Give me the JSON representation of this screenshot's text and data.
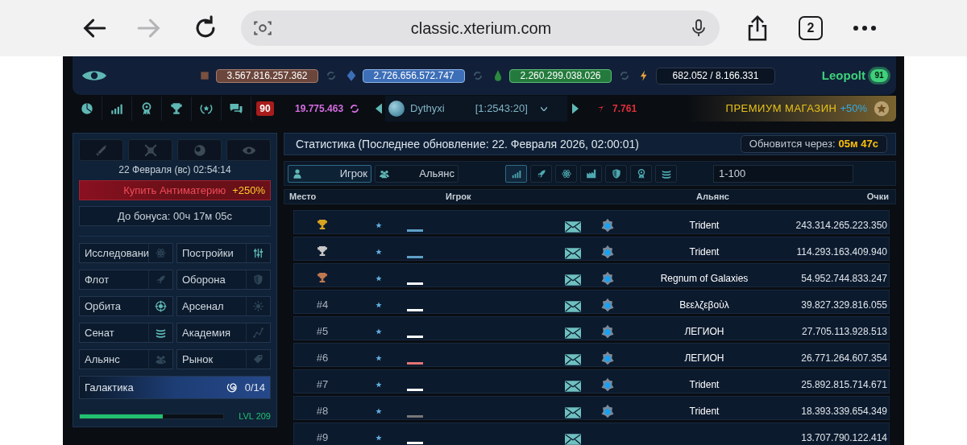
{
  "browser": {
    "url": "classic.xterium.com",
    "tab_count": "2",
    "forward_disabled": true
  },
  "header": {
    "resources": [
      {
        "kind": "metal",
        "value": "3.567.816.257.362"
      },
      {
        "kind": "crystal",
        "value": "2.726.656.572.747"
      },
      {
        "kind": "deuterium",
        "value": "2.260.299.038.026"
      }
    ],
    "energy": "682.052 / 8.166.331",
    "player": "Leopolt",
    "player_level": "91"
  },
  "subheader": {
    "messages_badge": "90",
    "antimatter": "19.775.463",
    "planet": "Dythyxi",
    "coords": "[1:2543:20]",
    "darkmatter": "7.761",
    "premium": "ПРЕМИУМ МАГАЗИН",
    "premium_bonus": "+50%"
  },
  "sidebar": {
    "date": "22 Февраля (вс) 02:54:14",
    "buy": "Купить Антиматерию",
    "buy_bonus": "+250%",
    "bonus_timer": "До бонуса: 00ч 17м 05с",
    "items": [
      {
        "label": "Исследовани",
        "bright": false
      },
      {
        "label": "Постройки",
        "bright": true
      },
      {
        "label": "Флот",
        "bright": false
      },
      {
        "label": "Оборона",
        "bright": false
      },
      {
        "label": "Орбита",
        "bright": true
      },
      {
        "label": "Арсенал",
        "bright": false
      },
      {
        "label": "Сенат",
        "bright": true
      },
      {
        "label": "Академия",
        "bright": false
      },
      {
        "label": "Альянс",
        "bright": false
      },
      {
        "label": "Рынок",
        "bright": false
      }
    ],
    "galaxy": {
      "label": "Галактика",
      "count": "0/14"
    },
    "level": {
      "level": 0.58,
      "label": "LVL 209"
    }
  },
  "stats": {
    "title": "Статистика (Последнее обновление: 22. Февраля 2026, 02:00:01)",
    "refresh_label": "Обновится через:",
    "refresh_time": "05м 47с",
    "modes": [
      {
        "label": "Игрок",
        "selected": true
      },
      {
        "label": "Альянс",
        "selected": false
      }
    ],
    "categories": [
      {
        "selected": true
      },
      {
        "selected": false
      },
      {
        "selected": false
      },
      {
        "selected": false
      },
      {
        "selected": false
      },
      {
        "selected": false
      },
      {
        "selected": false
      }
    ],
    "range": "1-100",
    "columns": [
      "Место",
      "Игрок",
      "Альянс",
      "Очки"
    ],
    "rows": [
      {
        "kind": "trophy",
        "color": "#5fa0c8",
        "alliance": "Trident",
        "points": "243.314.265.223.350"
      },
      {
        "kind": "trophy",
        "color": "#5fa0c8",
        "alliance": "Trident",
        "points": "114.293.163.409.940"
      },
      {
        "kind": "trophy",
        "color": "#ffffff",
        "alliance": "Regnum of Galaxies",
        "points": "54.952.744.833.247"
      },
      {
        "rank": "#4",
        "color": "#ffffff",
        "alliance": "Βεελζεβοὺλ",
        "points": "39.827.329.816.055"
      },
      {
        "rank": "#5",
        "color": "#ffffff",
        "alliance": "ЛЕГИОН",
        "points": "27.705.113.928.513"
      },
      {
        "rank": "#6",
        "color": "#e57373",
        "alliance": "ЛЕГИОН",
        "points": "26.771.264.607.354"
      },
      {
        "rank": "#7",
        "color": "#ffffff",
        "alliance": "Trident",
        "points": "25.892.815.714.671"
      },
      {
        "rank": "#8",
        "color": "#777777",
        "alliance": "Trident",
        "points": "18.393.339.654.349"
      },
      {
        "rank": "#9",
        "color": "#ffffff",
        "points": "13.707.790.122.414"
      }
    ]
  }
}
